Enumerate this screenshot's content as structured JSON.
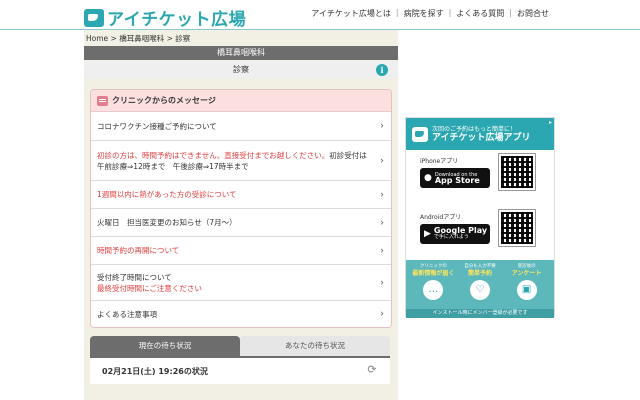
{
  "header": {
    "logo_text": "アイチケット広場",
    "nav": [
      "アイチケット広場とは",
      "病院を探す",
      "よくある質問",
      "お問合せ"
    ]
  },
  "breadcrumb": "Home > 橋耳鼻咽喉科 > 診察",
  "page": {
    "clinic_name": "橋耳鼻咽喉科",
    "section": "診察"
  },
  "messages": {
    "heading": "クリニックからのメッセージ",
    "items": [
      {
        "lines": [
          "コロナワクチン接種ご予約について"
        ],
        "red": [
          false
        ]
      },
      {
        "lines": [
          "初診の方は、時間予約はできません。直接受付までお越しください。",
          "初診受付は午前診療⇒12時まで　午後診療⇒17時半まで"
        ],
        "red": [
          true,
          false
        ]
      },
      {
        "lines": [
          "1週間以内に熱があった方の受診について"
        ],
        "red": [
          true
        ]
      },
      {
        "lines": [
          "火曜日　担当医変更のお知らせ（7月〜）"
        ],
        "red": [
          false
        ]
      },
      {
        "lines": [
          "時間予約の再開について"
        ],
        "red": [
          true
        ]
      },
      {
        "lines": [
          "受付終了時間について",
          "最終受付時間にご注意ください"
        ],
        "red": [
          false,
          true
        ]
      },
      {
        "lines": [
          "よくある注意事項"
        ],
        "red": [
          false
        ]
      }
    ]
  },
  "tabs": {
    "current": "現在の待ち状況",
    "yours": "あなたの待ち状況"
  },
  "status": {
    "datetime": "02月21日(土) 19:26の状況"
  },
  "ad": {
    "tagline": "次回のご予約はもっと簡単に！",
    "app_name": "アイチケット広場アプリ",
    "iphone_label": "iPhoneアプリ",
    "appstore_small": "Download on the",
    "appstore_big": "App Store",
    "android_label": "Androidアプリ",
    "googleplay_big": "Google Play",
    "googleplay_small": "で手に入れよう",
    "features": [
      {
        "small": "クリニックの",
        "label": "最新情報が届く"
      },
      {
        "small": "自分も入力不要",
        "label": "簡単予約"
      },
      {
        "small": "受診後の",
        "label": "アンケート"
      }
    ],
    "footer": "インストール時にメンバー登録が必要です"
  }
}
